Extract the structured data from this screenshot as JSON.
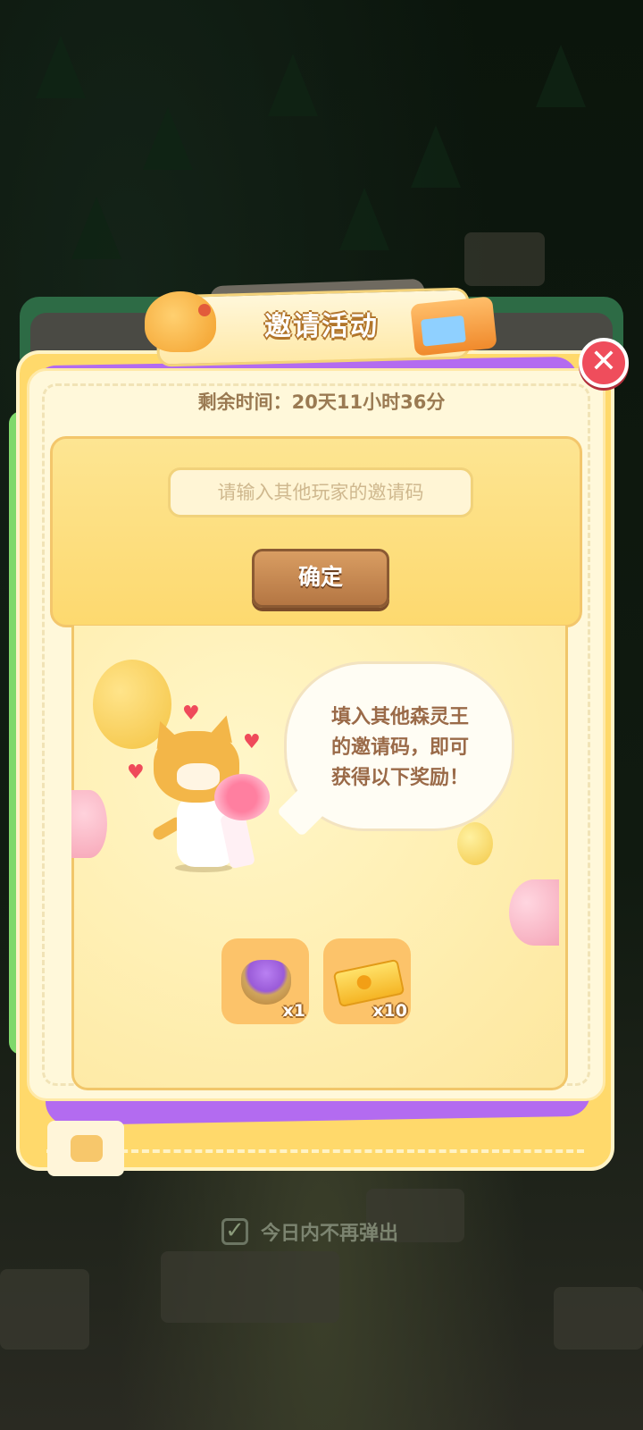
{
  "popup": {
    "title": "邀请活动",
    "remaining_time": "剩余时间：20天11小时36分",
    "input_placeholder": "请输入其他玩家的邀请码",
    "confirm_label": "确定",
    "close_symbol": "✕"
  },
  "reward_intro": {
    "line1": "填入其他森灵王",
    "line2": "的邀请码，即可",
    "line3": "获得以下奖励！"
  },
  "rewards": [
    {
      "icon": "flower-basket-icon",
      "count": "x1"
    },
    {
      "icon": "ticket-icon",
      "count": "x10"
    }
  ],
  "footer": {
    "checkbox_checked": true,
    "checkbox_symbol": "✓",
    "no_show_label": "今日内不再弹出"
  },
  "colors": {
    "card_yellow": "#ffd96b",
    "confirm_brown": "#b47643",
    "close_red": "#ef4d5c"
  }
}
